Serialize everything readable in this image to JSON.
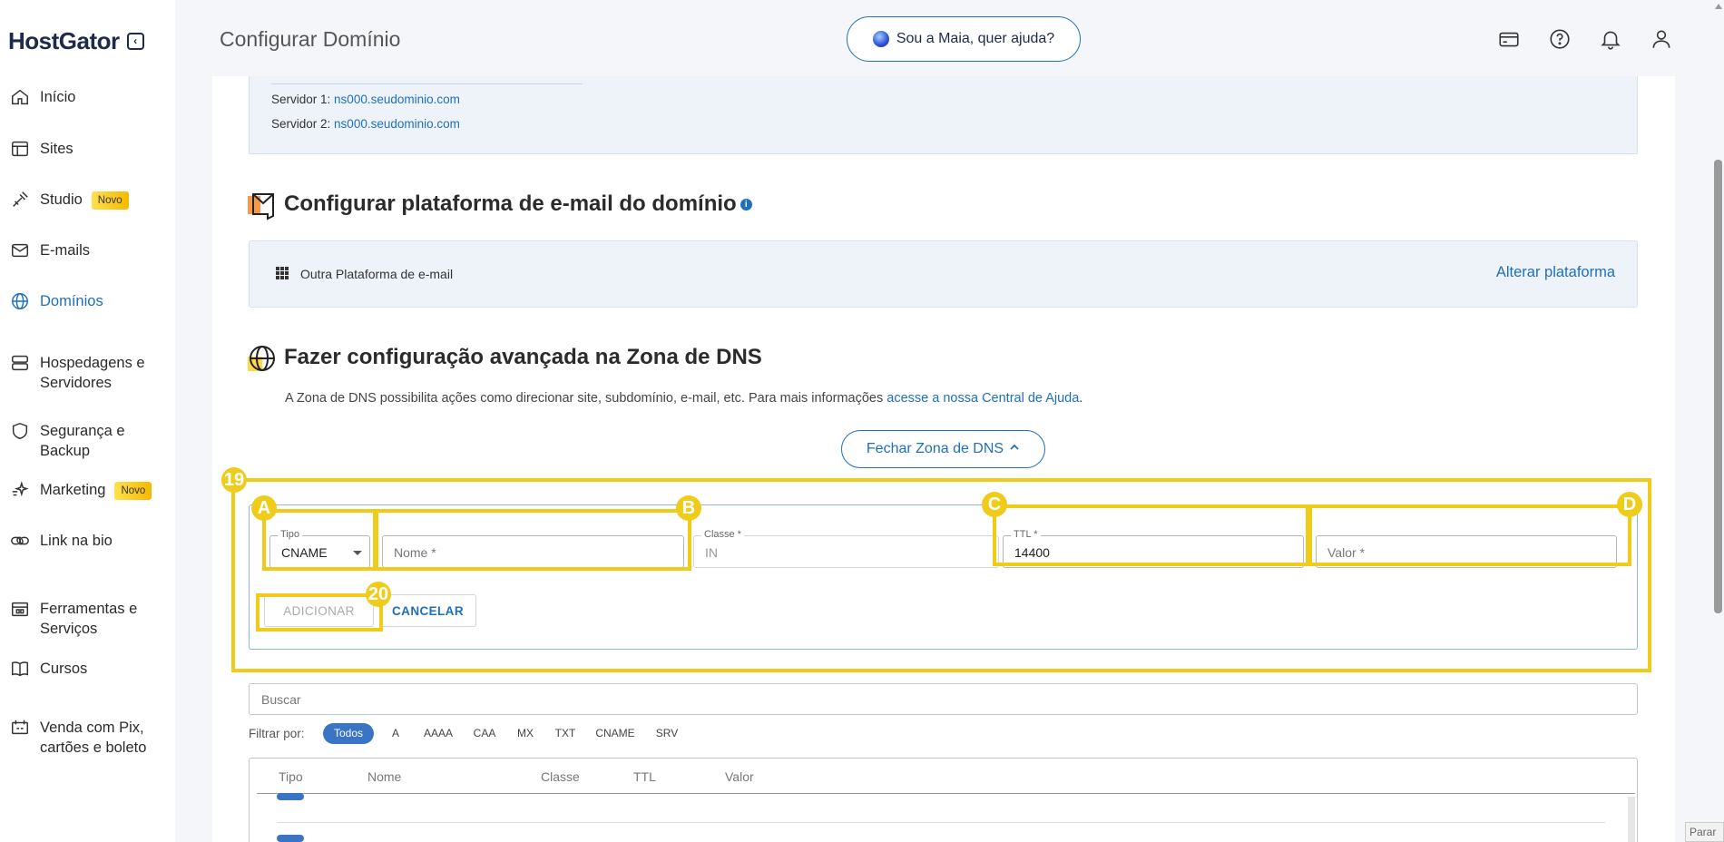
{
  "brand": {
    "name": "HostGator",
    "toggle_icon": "collapse-icon"
  },
  "sidebar": {
    "items": [
      {
        "label": "Início",
        "icon": "home-icon"
      },
      {
        "label": "Sites",
        "icon": "layout-icon"
      },
      {
        "label": "Studio",
        "badge": "Novo",
        "icon": "studio-icon"
      },
      {
        "label": "E-mails",
        "icon": "mail-icon"
      },
      {
        "label": "Domínios",
        "icon": "globe-icon",
        "active": true
      },
      {
        "label": "Hospedagens e",
        "label2": "Servidores",
        "icon": "server-icon"
      },
      {
        "label": "Segurança e",
        "label2": "Backup",
        "icon": "shield-icon"
      },
      {
        "label": "Marketing",
        "badge": "Novo",
        "icon": "sparkle-icon"
      },
      {
        "label": "Link na bio",
        "icon": "link-icon"
      },
      {
        "label": "Ferramentas e",
        "label2": "Serviços",
        "icon": "tools-icon"
      },
      {
        "label": "Cursos",
        "icon": "book-icon"
      },
      {
        "label": "Venda com Pix,",
        "label2": "cartões e boleto",
        "icon": "sale-icon"
      }
    ]
  },
  "header": {
    "title": "Configurar Domínio",
    "maia_label": "Sou a Maia, quer ajuda?"
  },
  "nameservers": {
    "server1_label": "Servidor 1:",
    "server1_value": "ns000.seudominio.com",
    "server2_label": "Servidor 2:",
    "server2_value": "ns000.seudominio.com"
  },
  "email_section": {
    "title": "Configurar plataforma de e-mail do domínio",
    "info_icon": "i",
    "platform": "Outra Plataforma de e-mail",
    "change_label": "Alterar plataforma"
  },
  "dns_section": {
    "title": "Fazer configuração avançada na Zona de DNS",
    "description": "A Zona de DNS possibilita ações como direcionar site, subdomínio, e-mail, etc. Para mais informações",
    "help_link": "acesse a nossa Central de Ajuda",
    "period": ".",
    "close_label": "Fechar Zona de DNS",
    "close_icon": "chevron-up-icon"
  },
  "record_form": {
    "tipo_label": "Tipo",
    "tipo_value": "CNAME",
    "nome_placeholder": "Nome *",
    "classe_label": "Classe *",
    "classe_value": "IN",
    "ttl_label": "TTL *",
    "ttl_value": "14400",
    "valor_placeholder": "Valor *",
    "add_label": "ADICIONAR",
    "cancel_label": "CANCELAR"
  },
  "annotations": {
    "box_main": "19",
    "box_add": "20",
    "a": "A",
    "b": "B",
    "c": "C",
    "d": "D"
  },
  "records": {
    "search_placeholder": "Buscar",
    "filter_label": "Filtrar por:",
    "filters": [
      "Todos",
      "A",
      "AAAA",
      "CAA",
      "MX",
      "TXT",
      "CNAME",
      "SRV"
    ],
    "active_filter": "Todos",
    "columns": [
      "Tipo",
      "Nome",
      "Classe",
      "TTL",
      "Valor"
    ]
  },
  "corner_text": "Parar",
  "colors": {
    "accent": "#1f6fbf",
    "highlight": "#f0cc1a",
    "badge": "#f5b800"
  }
}
